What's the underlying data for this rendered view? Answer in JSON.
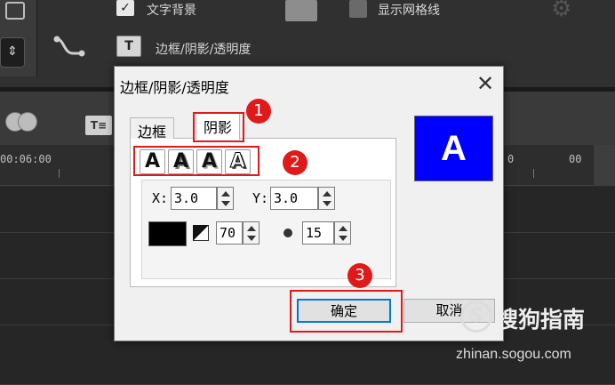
{
  "background": {
    "text_bg_label": "文字背景",
    "show_grid_label": "显示网格线",
    "border_shadow_label": "边框/阴影/透明度",
    "ruler_left": "00:06:00",
    "ruler_right_a": "0",
    "ruler_right_b": "00",
    "check_mark": "✓",
    "t_icon": "T",
    "ti_icon": "T≡",
    "spin_arrows": "⇕"
  },
  "dialog": {
    "title": "边框/阴影/透明度",
    "close": "✕",
    "tabs": [
      "边框",
      "阴影"
    ],
    "active_tab": "阴影",
    "shadow_styles": [
      "A",
      "A",
      "A",
      "A"
    ],
    "x_label": "X:",
    "x_value": "3.0",
    "y_label": "Y:",
    "y_value": "3.0",
    "shadow_color": "#000000",
    "opacity_value": "70",
    "blur_value": "15",
    "preview_letter": "A",
    "preview_bg": "#0000ff",
    "ok_label": "确定",
    "cancel_label": "取消"
  },
  "annotations": {
    "markers": [
      "1",
      "2",
      "3"
    ],
    "color": "#e01a1a"
  },
  "watermark": {
    "logo": "S",
    "brand": "搜狗指南",
    "url": "zhinan.sogou.com"
  }
}
